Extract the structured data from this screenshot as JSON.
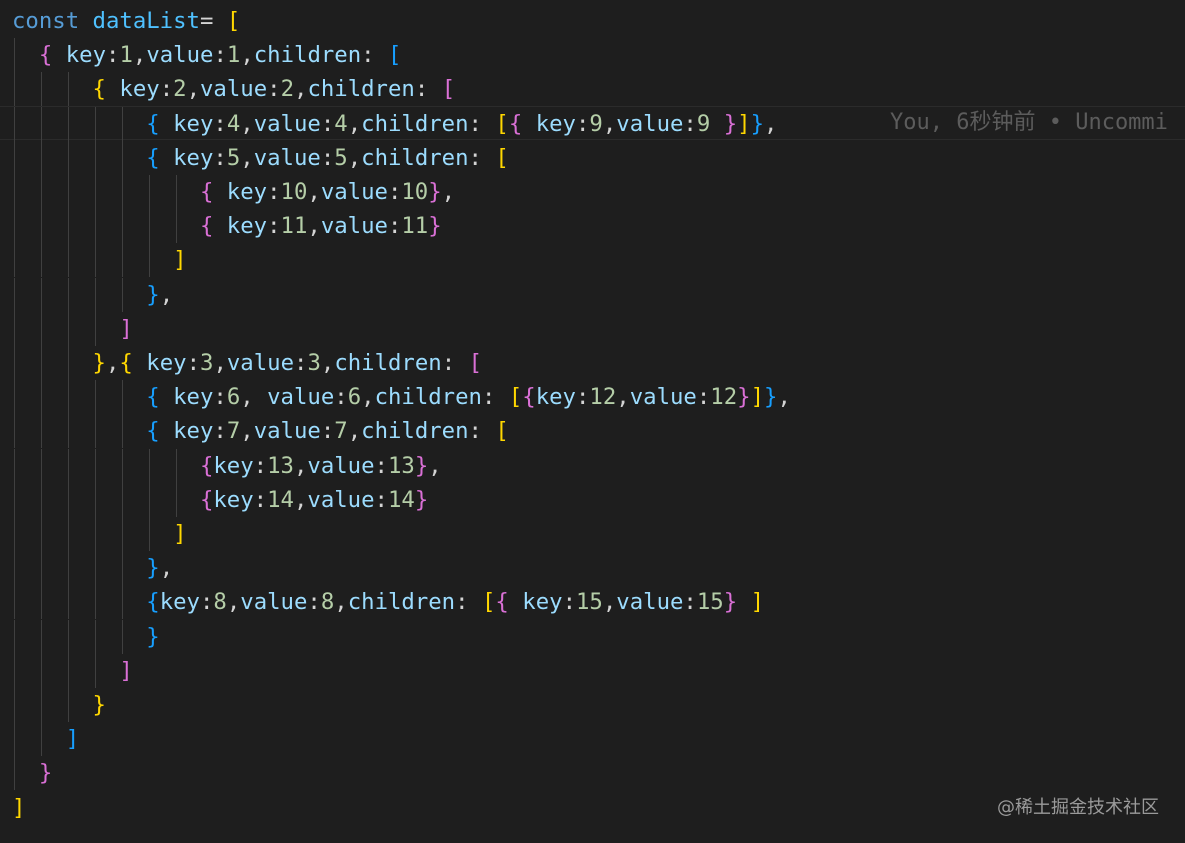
{
  "editor": {
    "lines": [
      [
        [
          "kw",
          "const "
        ],
        [
          "var",
          "dataList"
        ],
        [
          "p",
          "= "
        ],
        [
          "b1",
          "["
        ]
      ],
      [
        [
          "p",
          "  "
        ],
        [
          "b2",
          "{"
        ],
        [
          "prop",
          " key"
        ],
        [
          "p",
          ":"
        ],
        [
          "num",
          "1"
        ],
        [
          "p",
          ","
        ],
        [
          "prop",
          "value"
        ],
        [
          "p",
          ":"
        ],
        [
          "num",
          "1"
        ],
        [
          "p",
          ","
        ],
        [
          "prop",
          "children"
        ],
        [
          "p",
          ": "
        ],
        [
          "b3",
          "["
        ]
      ],
      [
        [
          "p",
          "      "
        ],
        [
          "b1",
          "{"
        ],
        [
          "prop",
          " key"
        ],
        [
          "p",
          ":"
        ],
        [
          "num",
          "2"
        ],
        [
          "p",
          ","
        ],
        [
          "prop",
          "value"
        ],
        [
          "p",
          ":"
        ],
        [
          "num",
          "2"
        ],
        [
          "p",
          ","
        ],
        [
          "prop",
          "children"
        ],
        [
          "p",
          ": "
        ],
        [
          "b2",
          "["
        ]
      ],
      [
        [
          "p",
          "          "
        ],
        [
          "b3",
          "{"
        ],
        [
          "prop",
          " key"
        ],
        [
          "p",
          ":"
        ],
        [
          "num",
          "4"
        ],
        [
          "p",
          ","
        ],
        [
          "prop",
          "value"
        ],
        [
          "p",
          ":"
        ],
        [
          "num",
          "4"
        ],
        [
          "p",
          ","
        ],
        [
          "prop",
          "children"
        ],
        [
          "p",
          ": "
        ],
        [
          "b1",
          "["
        ],
        [
          "b2",
          "{"
        ],
        [
          "prop",
          " key"
        ],
        [
          "p",
          ":"
        ],
        [
          "num",
          "9"
        ],
        [
          "p",
          ","
        ],
        [
          "prop",
          "value"
        ],
        [
          "p",
          ":"
        ],
        [
          "num",
          "9"
        ],
        [
          "p",
          " "
        ],
        [
          "b2",
          "}"
        ],
        [
          "b1",
          "]"
        ],
        [
          "b3",
          "}"
        ],
        [
          "p",
          ","
        ]
      ],
      [
        [
          "p",
          "          "
        ],
        [
          "b3",
          "{"
        ],
        [
          "prop",
          " key"
        ],
        [
          "p",
          ":"
        ],
        [
          "num",
          "5"
        ],
        [
          "p",
          ","
        ],
        [
          "prop",
          "value"
        ],
        [
          "p",
          ":"
        ],
        [
          "num",
          "5"
        ],
        [
          "p",
          ","
        ],
        [
          "prop",
          "children"
        ],
        [
          "p",
          ": "
        ],
        [
          "b1",
          "["
        ]
      ],
      [
        [
          "p",
          "              "
        ],
        [
          "b2",
          "{"
        ],
        [
          "prop",
          " key"
        ],
        [
          "p",
          ":"
        ],
        [
          "num",
          "10"
        ],
        [
          "p",
          ","
        ],
        [
          "prop",
          "value"
        ],
        [
          "p",
          ":"
        ],
        [
          "num",
          "10"
        ],
        [
          "b2",
          "}"
        ],
        [
          "p",
          ","
        ]
      ],
      [
        [
          "p",
          "              "
        ],
        [
          "b2",
          "{"
        ],
        [
          "prop",
          " key"
        ],
        [
          "p",
          ":"
        ],
        [
          "num",
          "11"
        ],
        [
          "p",
          ","
        ],
        [
          "prop",
          "value"
        ],
        [
          "p",
          ":"
        ],
        [
          "num",
          "11"
        ],
        [
          "b2",
          "}"
        ]
      ],
      [
        [
          "p",
          "            "
        ],
        [
          "b1",
          "]"
        ]
      ],
      [
        [
          "p",
          "          "
        ],
        [
          "b3",
          "}"
        ],
        [
          "p",
          ","
        ]
      ],
      [
        [
          "p",
          "        "
        ],
        [
          "b2",
          "]"
        ]
      ],
      [
        [
          "p",
          "      "
        ],
        [
          "b1",
          "}"
        ],
        [
          "p",
          ","
        ],
        [
          "b1",
          "{"
        ],
        [
          "prop",
          " key"
        ],
        [
          "p",
          ":"
        ],
        [
          "num",
          "3"
        ],
        [
          "p",
          ","
        ],
        [
          "prop",
          "value"
        ],
        [
          "p",
          ":"
        ],
        [
          "num",
          "3"
        ],
        [
          "p",
          ","
        ],
        [
          "prop",
          "children"
        ],
        [
          "p",
          ": "
        ],
        [
          "b2",
          "["
        ]
      ],
      [
        [
          "p",
          "          "
        ],
        [
          "b3",
          "{"
        ],
        [
          "prop",
          " key"
        ],
        [
          "p",
          ":"
        ],
        [
          "num",
          "6"
        ],
        [
          "p",
          ", "
        ],
        [
          "prop",
          "value"
        ],
        [
          "p",
          ":"
        ],
        [
          "num",
          "6"
        ],
        [
          "p",
          ","
        ],
        [
          "prop",
          "children"
        ],
        [
          "p",
          ": "
        ],
        [
          "b1",
          "["
        ],
        [
          "b2",
          "{"
        ],
        [
          "prop",
          "key"
        ],
        [
          "p",
          ":"
        ],
        [
          "num",
          "12"
        ],
        [
          "p",
          ","
        ],
        [
          "prop",
          "value"
        ],
        [
          "p",
          ":"
        ],
        [
          "num",
          "12"
        ],
        [
          "b2",
          "}"
        ],
        [
          "b1",
          "]"
        ],
        [
          "b3",
          "}"
        ],
        [
          "p",
          ","
        ]
      ],
      [
        [
          "p",
          "          "
        ],
        [
          "b3",
          "{"
        ],
        [
          "prop",
          " key"
        ],
        [
          "p",
          ":"
        ],
        [
          "num",
          "7"
        ],
        [
          "p",
          ","
        ],
        [
          "prop",
          "value"
        ],
        [
          "p",
          ":"
        ],
        [
          "num",
          "7"
        ],
        [
          "p",
          ","
        ],
        [
          "prop",
          "children"
        ],
        [
          "p",
          ": "
        ],
        [
          "b1",
          "["
        ]
      ],
      [
        [
          "p",
          "              "
        ],
        [
          "b2",
          "{"
        ],
        [
          "prop",
          "key"
        ],
        [
          "p",
          ":"
        ],
        [
          "num",
          "13"
        ],
        [
          "p",
          ","
        ],
        [
          "prop",
          "value"
        ],
        [
          "p",
          ":"
        ],
        [
          "num",
          "13"
        ],
        [
          "b2",
          "}"
        ],
        [
          "p",
          ","
        ]
      ],
      [
        [
          "p",
          "              "
        ],
        [
          "b2",
          "{"
        ],
        [
          "prop",
          "key"
        ],
        [
          "p",
          ":"
        ],
        [
          "num",
          "14"
        ],
        [
          "p",
          ","
        ],
        [
          "prop",
          "value"
        ],
        [
          "p",
          ":"
        ],
        [
          "num",
          "14"
        ],
        [
          "b2",
          "}"
        ]
      ],
      [
        [
          "p",
          "            "
        ],
        [
          "b1",
          "]"
        ]
      ],
      [
        [
          "p",
          "          "
        ],
        [
          "b3",
          "}"
        ],
        [
          "p",
          ","
        ]
      ],
      [
        [
          "p",
          "          "
        ],
        [
          "b3",
          "{"
        ],
        [
          "prop",
          "key"
        ],
        [
          "p",
          ":"
        ],
        [
          "num",
          "8"
        ],
        [
          "p",
          ","
        ],
        [
          "prop",
          "value"
        ],
        [
          "p",
          ":"
        ],
        [
          "num",
          "8"
        ],
        [
          "p",
          ","
        ],
        [
          "prop",
          "children"
        ],
        [
          "p",
          ": "
        ],
        [
          "b1",
          "["
        ],
        [
          "b2",
          "{"
        ],
        [
          "prop",
          " key"
        ],
        [
          "p",
          ":"
        ],
        [
          "num",
          "15"
        ],
        [
          "p",
          ","
        ],
        [
          "prop",
          "value"
        ],
        [
          "p",
          ":"
        ],
        [
          "num",
          "15"
        ],
        [
          "b2",
          "}"
        ],
        [
          "p",
          " "
        ],
        [
          "b1",
          "]"
        ]
      ],
      [
        [
          "p",
          "          "
        ],
        [
          "b3",
          "}"
        ]
      ],
      [
        [
          "p",
          "        "
        ],
        [
          "b2",
          "]"
        ]
      ],
      [
        [
          "p",
          "      "
        ],
        [
          "b1",
          "}"
        ]
      ],
      [
        [
          "p",
          "    "
        ],
        [
          "b3",
          "]"
        ]
      ],
      [
        [
          "p",
          "  "
        ],
        [
          "b2",
          "}"
        ]
      ],
      [
        [
          "b1",
          "]"
        ]
      ]
    ],
    "blame_text": "You, 6秒钟前 • Uncommi"
  },
  "watermark": "@稀土掘金技术社区",
  "colors": {
    "background": "#1e1e1e",
    "keyword": "#569cd6",
    "variable": "#4fc1ff",
    "property": "#9cdcfe",
    "number": "#b5cea8",
    "bracket_gold": "#ffd700",
    "bracket_orchid": "#da70d6",
    "bracket_blue": "#179fff",
    "blame": "#5c5c5c"
  }
}
